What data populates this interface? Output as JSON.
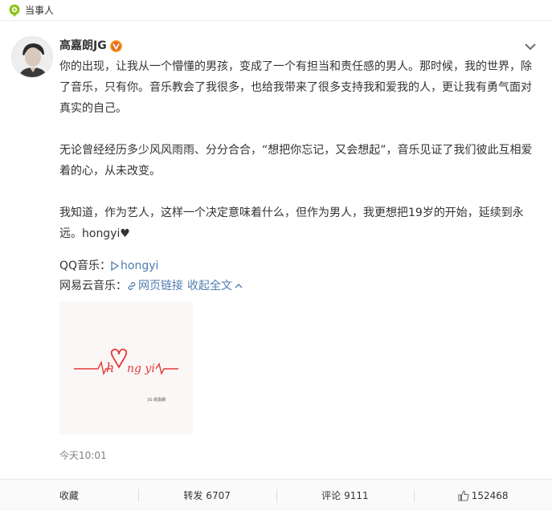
{
  "topbar": {
    "icon": "location-pin-icon",
    "label": "当事人"
  },
  "user": {
    "name": "高嘉朗JG",
    "badge_icon": "verified-v-icon"
  },
  "post": {
    "paragraphs": [
      "你的出现，让我从一个懵懂的男孩，变成了一个有担当和责任感的男人。那时候，我的世界，除了音乐，只有你。音乐教会了我很多，也给我带来了很多支持我和爱我的人，更让我有勇气面对真实的自己。",
      "无论曾经经历多少风风雨雨、分分合合，“想把你忘记，又会想起”，音乐见证了我们彼此互相爱着的心，从未改变。",
      "我知道，作为艺人，这样一个决定意味着什么，但作为男人，我更想把19岁的开始，延续到永远。hongyi"
    ],
    "heart": "♥"
  },
  "music": {
    "qq_label": "QQ音乐：",
    "qq_link": "hongyi",
    "netease_label": "网易云音乐：",
    "netease_link": "网页链接",
    "collapse": "收起全文"
  },
  "image": {
    "handwriting": "h",
    "handwriting2": "ng yi",
    "caption": "JG·高嘉朗"
  },
  "timestamp": "今天10:01",
  "actions": {
    "favorite": "收藏",
    "repost_label": "转发",
    "repost_count": "6707",
    "comment_label": "评论",
    "comment_count": "9111",
    "like_count": "152468"
  },
  "colors": {
    "accent_orange": "#eb7350",
    "link_blue": "#507daf",
    "heart_red": "#e23a3a",
    "topbar_green": "#8fc31f"
  }
}
